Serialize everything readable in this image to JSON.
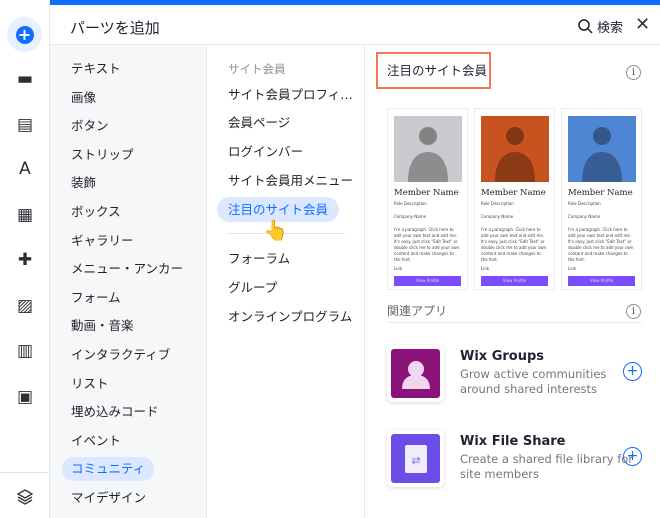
{
  "header": {
    "title": "パーツを追加",
    "search_label": "検索"
  },
  "rail": [
    "strip-icon",
    "page-icon",
    "theme-icon",
    "apps-icon",
    "add-ons-icon",
    "media-icon",
    "table-icon",
    "business-icon"
  ],
  "categories": [
    "テキスト",
    "画像",
    "ボタン",
    "ストリップ",
    "装飾",
    "ボックス",
    "ギャラリー",
    "メニュー・アンカー",
    "フォーム",
    "動画・音楽",
    "インタラクティブ",
    "リスト",
    "埋め込みコード",
    "イベント",
    "コミュニティ",
    "マイデザイン"
  ],
  "selected_category": "コミュニティ",
  "sub": {
    "heading": "サイト会員",
    "items": [
      "サイト会員プロフィ…",
      "会員ページ",
      "ログインバー",
      "サイト会員用メニュー",
      "注目のサイト会員"
    ],
    "items2": [
      "フォーラム",
      "グループ",
      "オンラインプログラム"
    ],
    "selected": "注目のサイト会員"
  },
  "panel": {
    "section_title": "注目のサイト会員",
    "cards": [
      {
        "name": "Member Name",
        "role": "Role Description",
        "company": "Company Name",
        "para": "I'm a paragraph. Click here to add your own text and edit me. It's easy. Just click \"Edit Text\" or double click me to add your own content and make changes to the font.",
        "link": "Link",
        "button": "View Profile",
        "photo_color": "#c9cacd"
      },
      {
        "name": "Member Name",
        "role": "Role Description",
        "company": "Company Name",
        "para": "I'm a paragraph. Click here to add your own text and edit me. It's easy. Just click \"Edit Text\" or double click me to add your own content and make changes to the font.",
        "link": "Link",
        "button": "View Profile",
        "photo_color": "#c8531f"
      },
      {
        "name": "Member Name",
        "role": "Role Description",
        "company": "Company Name",
        "para": "I'm a paragraph. Click here to add your own text and edit me. It's easy. Just click \"Edit Text\" or double click me to add your own content and make changes to the font.",
        "link": "Link",
        "button": "View Profile",
        "photo_color": "#4f86d4"
      }
    ],
    "related_title": "関連アプリ",
    "apps": [
      {
        "name": "Wix Groups",
        "desc": "Grow active communities around shared interests",
        "color": "#8a1278"
      },
      {
        "name": "Wix File Share",
        "desc": "Create a shared file library for site members",
        "color": "#6c4de6"
      }
    ]
  }
}
